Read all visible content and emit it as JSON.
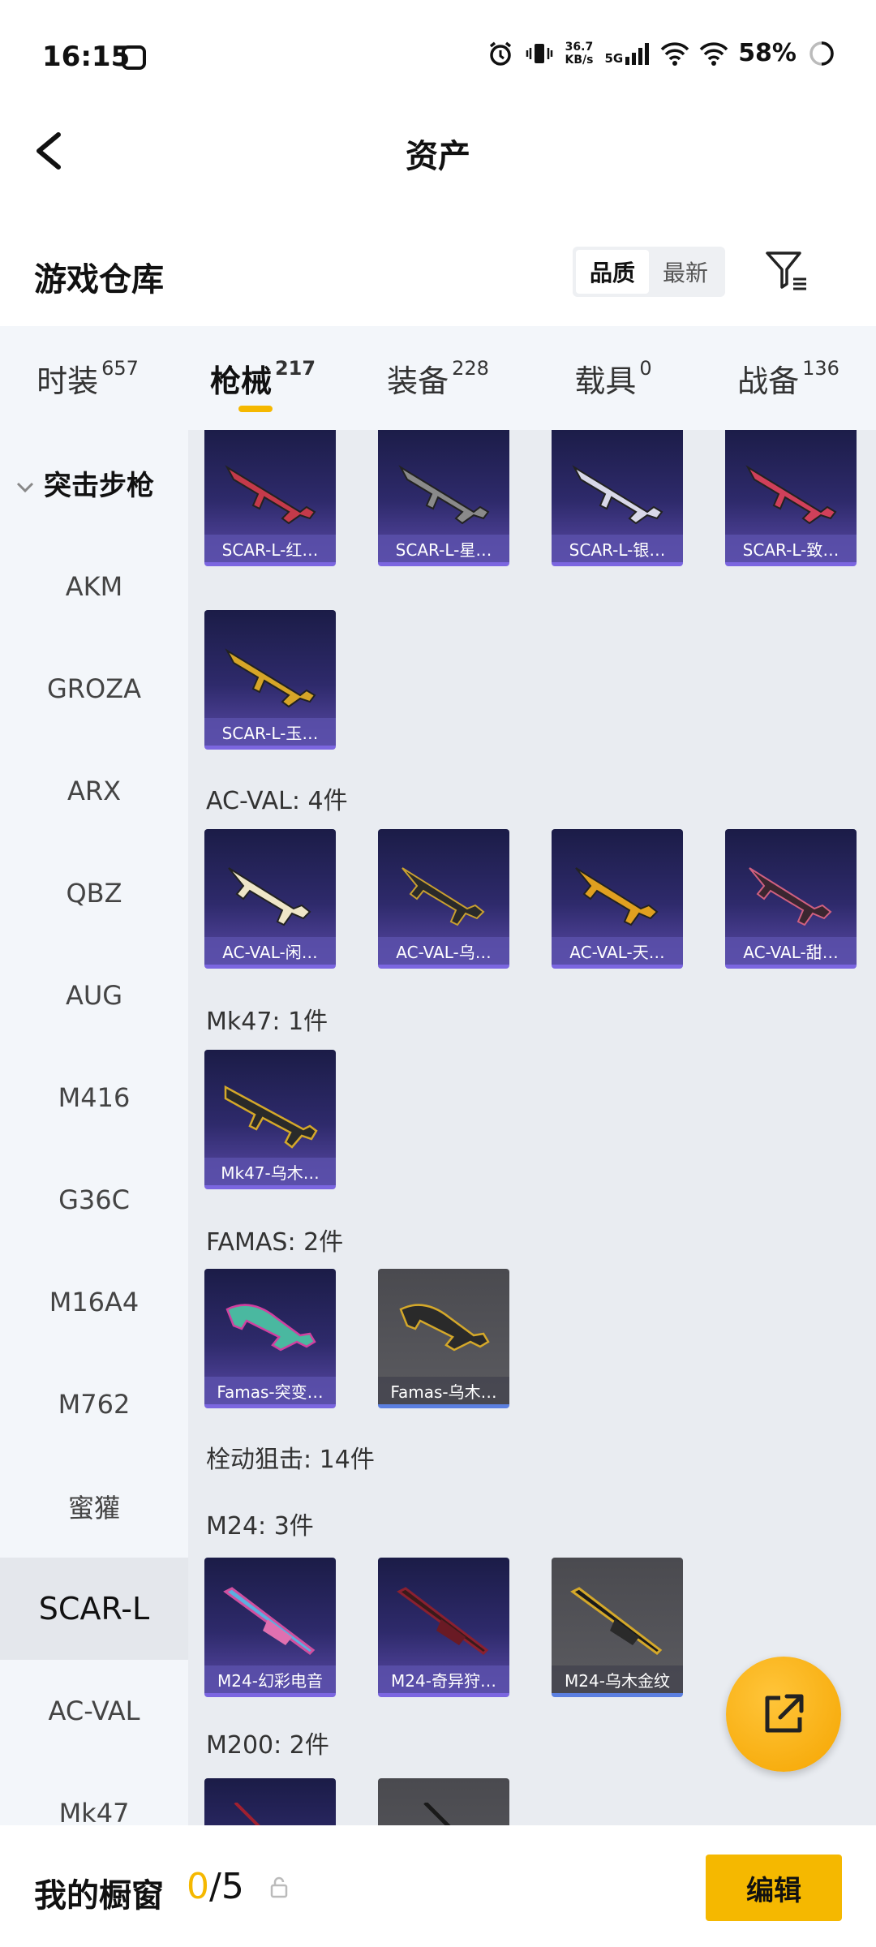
{
  "status": {
    "time": "16:15",
    "net_speed_value": "36.7",
    "net_speed_unit": "KB/s",
    "network": "5G",
    "battery": "58%"
  },
  "header": {
    "title": "资产"
  },
  "repo": {
    "label": "游戏仓库",
    "sort_options": [
      "品质",
      "最新"
    ],
    "active_sort": "品质"
  },
  "tabs": [
    {
      "label": "时装",
      "count": "657"
    },
    {
      "label": "枪械",
      "count": "217"
    },
    {
      "label": "装备",
      "count": "228"
    },
    {
      "label": "载具",
      "count": "0"
    },
    {
      "label": "战备",
      "count": "136"
    }
  ],
  "sidebar": {
    "group": "突击步枪",
    "items": [
      "AKM",
      "GROZA",
      "ARX",
      "QBZ",
      "AUG",
      "M416",
      "G36C",
      "M16A4",
      "M762",
      "蜜獾",
      "SCAR-L",
      "AC-VAL",
      "Mk47"
    ],
    "active": "SCAR-L"
  },
  "sections": {
    "scar_row1": [
      "SCAR-L-红…",
      "SCAR-L-星…",
      "SCAR-L-银…",
      "SCAR-L-致…"
    ],
    "scar_row2": [
      "SCAR-L-玉…"
    ],
    "acval_title": "AC-VAL: 4件",
    "acval": [
      "AC-VAL-闲…",
      "AC-VAL-乌…",
      "AC-VAL-天…",
      "AC-VAL-甜…"
    ],
    "mk47_title": "Mk47: 1件",
    "mk47": [
      "Mk47-乌木…"
    ],
    "famas_title": "FAMAS: 2件",
    "famas": [
      "Famas-突变…",
      "Famas-乌木…"
    ],
    "bolt_title": "栓动狙击: 14件",
    "m24_title": "M24: 3件",
    "m24": [
      "M24-幻彩电音",
      "M24-奇异狩…",
      "M24-乌木金纹"
    ],
    "m200_title": "M200: 2件"
  },
  "bottom": {
    "label": "我的橱窗",
    "count": "0",
    "total": "/5",
    "edit": "编辑"
  },
  "colors": {
    "accent": "#f5b800",
    "card_purple": "#2e2a6b",
    "card_grey": "#5b5b60"
  }
}
